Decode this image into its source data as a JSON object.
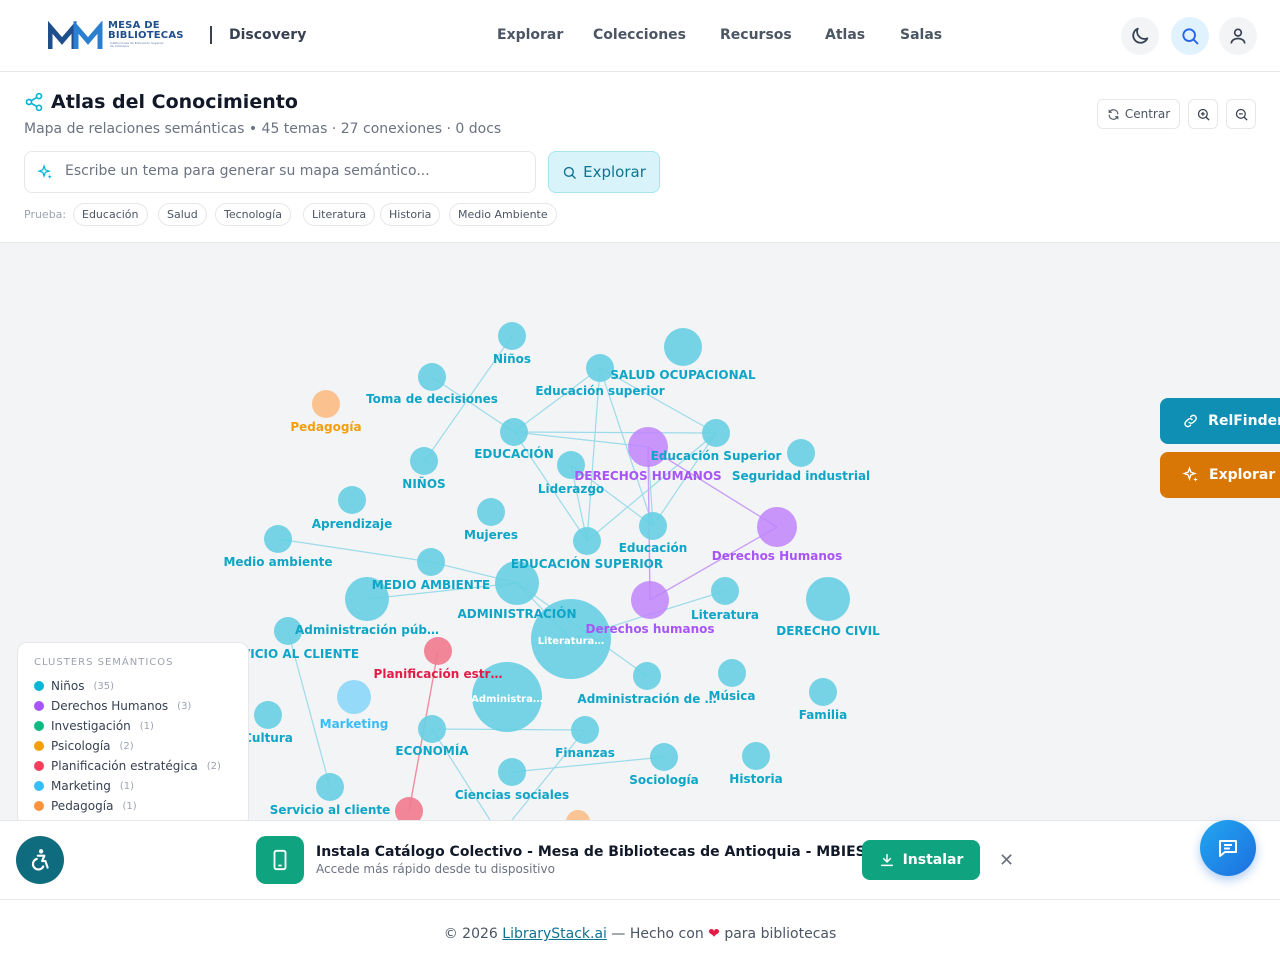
{
  "header": {
    "logo_text": "MESA DE BIBLIOTECAS",
    "logo_sub": "Instituciones de Educación Superior de Antioquia",
    "app_name": "Discovery",
    "nav": [
      "Explorar",
      "Colecciones",
      "Recursos",
      "Atlas",
      "Salas"
    ]
  },
  "atlas": {
    "title": "Atlas del Conocimiento",
    "subtitle": "Mapa de relaciones semánticas • 45 temas · 27 conexiones · 0 docs",
    "center_label": "Centrar",
    "search_placeholder": "Escribe un tema para generar su mapa semántico...",
    "explore_label": "Explorar",
    "prueba_label": "Prueba:",
    "suggestions": [
      "Educación",
      "Salud",
      "Tecnología",
      "Literatura",
      "Historia",
      "Medio Ambiente"
    ]
  },
  "graph": {
    "colors": {
      "cyan": "#67cfe3",
      "cyan_text": "#0ea5c6",
      "purple": "#c084fc",
      "purple_text": "#a855f7",
      "orange": "#fbbf8a",
      "orange_text": "#f59e0b",
      "red": "#f07a8e",
      "red_text": "#e11d48",
      "skyblue": "#7dd3fc",
      "skyblue_text": "#38bdf8"
    },
    "node_labels": {
      "ninos_top": "Niños",
      "toma_decisiones": "Toma de decisiones",
      "educacion_superior_lc": "Educación superior",
      "salud_ocupacional": "SALUD OCUPACIONAL",
      "pedagogia": "Pedagogía",
      "educacion_caps": "EDUCACIÓN",
      "derechos_humanos_caps": "DERECHOS HUMANOS",
      "educacion_superior_tc": "Educación Superior",
      "seguridad_industrial": "Seguridad industrial",
      "ninos_caps": "NIÑOS",
      "liderazgo": "Liderazgo",
      "aprendizaje": "Aprendizaje",
      "mujeres": "Mujeres",
      "educacion": "Educación",
      "derechos_humanos_tc": "Derechos Humanos",
      "medio_ambiente": "Medio ambiente",
      "educacion_superior_caps": "EDUCACIÓN SUPERIOR",
      "medio_ambiente_caps": "MEDIO AMBIENTE",
      "administracion_caps": "ADMINISTRACIÓN",
      "literatura": "Literatura",
      "derecho_civil": "DERECHO CIVIL",
      "administracion_pub": "Administración púb…",
      "derechos_humanos_lc": "Derechos humanos",
      "servicio_cliente_caps": "VICIO AL CLIENTE",
      "literatura_inner": "Literatura…",
      "planificacion": "Planificación estr…",
      "administracion_de": "Administración de …",
      "musica": "Música",
      "familia": "Familia",
      "administra_inner": "Administra…",
      "marketing": "Marketing",
      "cultura": "Cultura",
      "economia": "ECONOMÍA",
      "finanzas": "Finanzas",
      "sociologia": "Sociología",
      "historia": "Historia",
      "ciencias_sociales": "Ciencias sociales",
      "servicio_cliente": "Servicio al cliente"
    }
  },
  "legend": {
    "title": "CLUSTERS SEMÁNTICOS",
    "items": [
      {
        "label": "Niños",
        "count": "(35)",
        "color": "#06b6d4"
      },
      {
        "label": "Derechos Humanos",
        "count": "(3)",
        "color": "#a855f7"
      },
      {
        "label": "Investigación",
        "count": "(1)",
        "color": "#10b981"
      },
      {
        "label": "Psicología",
        "count": "(2)",
        "color": "#f59e0b"
      },
      {
        "label": "Planificación estratégica",
        "count": "(2)",
        "color": "#f43f5e"
      },
      {
        "label": "Marketing",
        "count": "(1)",
        "color": "#38bdf8"
      },
      {
        "label": "Pedagogía",
        "count": "(1)",
        "color": "#fb923c"
      }
    ]
  },
  "side": {
    "relfinder": "RelFinder",
    "explorar": "Explorar"
  },
  "install": {
    "title": "Instala Catálogo Colectivo - Mesa de Bibliotecas de Antioquia - MBIES",
    "subtitle": "Accede más rápido desde tu dispositivo",
    "button": "Instalar",
    "close": "✕"
  },
  "footer": {
    "prefix": "© 2026",
    "link": "LibraryStack.ai",
    "middle": "— Hecho con",
    "heart": "❤",
    "suffix": "para bibliotecas"
  }
}
